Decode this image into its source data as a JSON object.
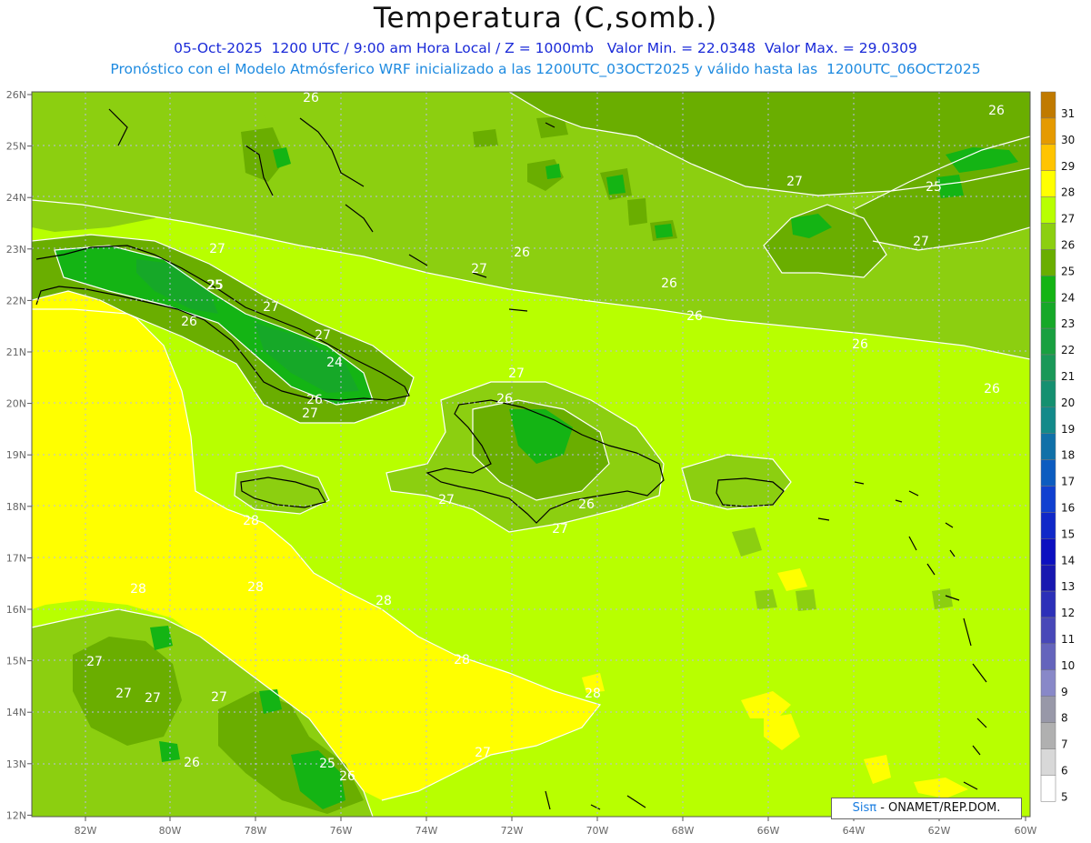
{
  "header": {
    "title": "Temperatura (C,somb.)",
    "line1": "05-Oct-2025  1200 UTC / 9:00 am Hora Local / Z = 1000mb   Valor Min. = 22.0348  Valor Max. = 29.0309",
    "line2": "Pronóstico con el Modelo Atmósferico WRF inicializado a las 1200UTC_03OCT2025 y válido hasta las  1200UTC_06OCT2025"
  },
  "axes": {
    "lon_labels": [
      "82W",
      "80W",
      "78W",
      "76W",
      "74W",
      "72W",
      "70W",
      "68W",
      "66W",
      "64W",
      "62W",
      "60W"
    ],
    "lat_labels": [
      "26N",
      "25N",
      "24N",
      "23N",
      "22N",
      "21N",
      "20N",
      "19N",
      "18N",
      "17N",
      "16N",
      "15N",
      "14N",
      "13N",
      "12N"
    ]
  },
  "colorbar": {
    "labels": [
      "31",
      "30",
      "29",
      "28",
      "27",
      "26",
      "25",
      "24",
      "23",
      "22",
      "21",
      "20",
      "19",
      "18",
      "17",
      "16",
      "15",
      "14",
      "13",
      "12",
      "11",
      "10",
      "9",
      "8",
      "7",
      "6",
      "5"
    ],
    "colors": [
      "#c07a00",
      "#e59a00",
      "#ffc400",
      "#ffff00",
      "#b8ff00",
      "#8ccf10",
      "#6aae00",
      "#14b414",
      "#16a828",
      "#19a040",
      "#1a9858",
      "#159070",
      "#138a8a",
      "#1070a8",
      "#0c5cc0",
      "#1040d0",
      "#1028c8",
      "#0c10c0",
      "#1818b0",
      "#2c30b8",
      "#4848b8",
      "#6464bc",
      "#8888c8",
      "#9898a8",
      "#b0b0b0",
      "#d8d8d8",
      "#ffffff"
    ]
  },
  "contour_labels": [
    "26",
    "26",
    "27",
    "27",
    "26",
    "26",
    "26",
    "25",
    "26",
    "27",
    "27",
    "26",
    "24",
    "26",
    "27",
    "27",
    "27",
    "26",
    "27",
    "26",
    "27",
    "28",
    "28",
    "28",
    "28",
    "28",
    "28",
    "27",
    "27",
    "27",
    "27",
    "27",
    "26",
    "25",
    "25",
    "27",
    "26",
    "25",
    "26"
  ],
  "credit": {
    "brand": "Sisπ",
    "text": " - ONAMET/REP.DOM."
  }
}
